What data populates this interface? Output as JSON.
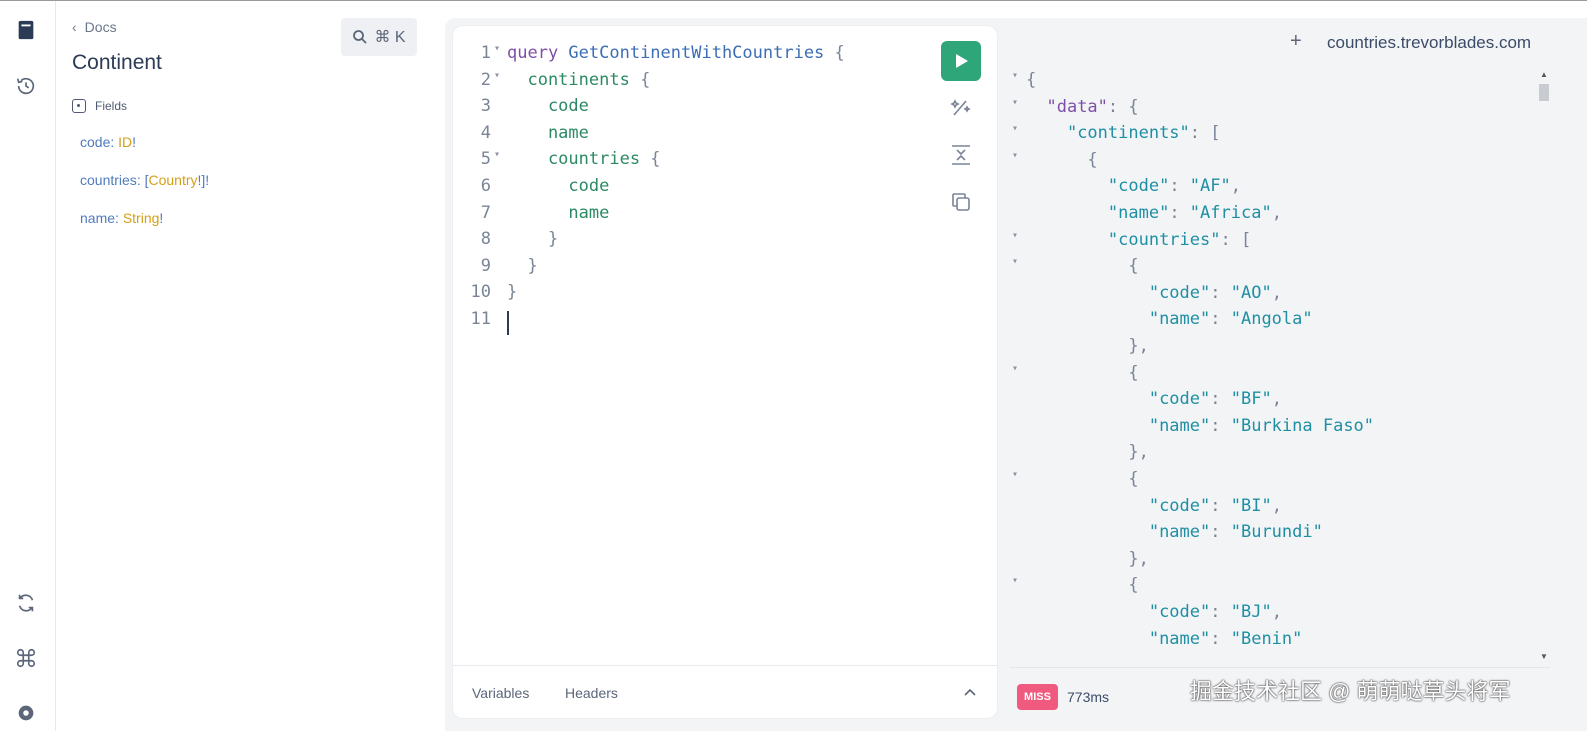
{
  "sidebar": {
    "icons": [
      "docs-book-icon",
      "history-icon",
      "refetch-schema-icon",
      "command-icon",
      "settings-gear-icon"
    ]
  },
  "docs": {
    "back_label": "Docs",
    "title": "Continent",
    "search_shortcut": "⌘ K",
    "fields_heading": "Fields",
    "fields": [
      {
        "name": "code",
        "sep": ": ",
        "pre": "",
        "type": "ID",
        "post": "!"
      },
      {
        "name": "countries",
        "sep": ": ",
        "pre": "[",
        "type": "Country",
        "post": "!]!"
      },
      {
        "name": "name",
        "sep": ": ",
        "pre": "",
        "type": "String",
        "post": "!"
      }
    ]
  },
  "editor": {
    "lines": [
      {
        "n": "1",
        "fold": true,
        "parts": [
          [
            "kw",
            "query "
          ],
          [
            "fn",
            "GetContinentWithCountries"
          ],
          [
            "pn",
            " {"
          ]
        ]
      },
      {
        "n": "2",
        "fold": true,
        "parts": [
          [
            "fld",
            "  continents"
          ],
          [
            "pn",
            " {"
          ]
        ]
      },
      {
        "n": "3",
        "fold": false,
        "parts": [
          [
            "fld",
            "    code"
          ]
        ]
      },
      {
        "n": "4",
        "fold": false,
        "parts": [
          [
            "fld",
            "    name"
          ]
        ]
      },
      {
        "n": "5",
        "fold": true,
        "parts": [
          [
            "fld",
            "    countries"
          ],
          [
            "pn",
            " {"
          ]
        ]
      },
      {
        "n": "6",
        "fold": false,
        "parts": [
          [
            "fld",
            "      code"
          ]
        ]
      },
      {
        "n": "7",
        "fold": false,
        "parts": [
          [
            "fld",
            "      name"
          ]
        ]
      },
      {
        "n": "8",
        "fold": false,
        "parts": [
          [
            "pn",
            "    }"
          ]
        ]
      },
      {
        "n": "9",
        "fold": false,
        "parts": [
          [
            "pn",
            "  }"
          ]
        ]
      },
      {
        "n": "10",
        "fold": false,
        "parts": [
          [
            "pn",
            "}"
          ]
        ]
      },
      {
        "n": "11",
        "fold": false,
        "parts": []
      }
    ],
    "tabs": {
      "variables": "Variables",
      "headers": "Headers"
    }
  },
  "results": {
    "add_tab": "+",
    "host": "countries.trevorblades.com",
    "lines": [
      {
        "fold": true,
        "parts": [
          [
            "rp",
            "{"
          ]
        ]
      },
      {
        "fold": true,
        "parts": [
          [
            "rp",
            "  "
          ],
          [
            "dkey",
            "\"data\""
          ],
          [
            "rp",
            ": {"
          ]
        ]
      },
      {
        "fold": true,
        "parts": [
          [
            "rp",
            "    "
          ],
          [
            "key",
            "\"continents\""
          ],
          [
            "rp",
            ": ["
          ]
        ]
      },
      {
        "fold": true,
        "parts": [
          [
            "rp",
            "      {"
          ]
        ]
      },
      {
        "fold": false,
        "parts": [
          [
            "rp",
            "        "
          ],
          [
            "key",
            "\"code\""
          ],
          [
            "rp",
            ": "
          ],
          [
            "str",
            "\"AF\""
          ],
          [
            "rp",
            ","
          ]
        ]
      },
      {
        "fold": false,
        "parts": [
          [
            "rp",
            "        "
          ],
          [
            "key",
            "\"name\""
          ],
          [
            "rp",
            ": "
          ],
          [
            "str",
            "\"Africa\""
          ],
          [
            "rp",
            ","
          ]
        ]
      },
      {
        "fold": true,
        "parts": [
          [
            "rp",
            "        "
          ],
          [
            "key",
            "\"countries\""
          ],
          [
            "rp",
            ": ["
          ]
        ]
      },
      {
        "fold": true,
        "parts": [
          [
            "rp",
            "          {"
          ]
        ]
      },
      {
        "fold": false,
        "parts": [
          [
            "rp",
            "            "
          ],
          [
            "key",
            "\"code\""
          ],
          [
            "rp",
            ": "
          ],
          [
            "str",
            "\"AO\""
          ],
          [
            "rp",
            ","
          ]
        ]
      },
      {
        "fold": false,
        "parts": [
          [
            "rp",
            "            "
          ],
          [
            "key",
            "\"name\""
          ],
          [
            "rp",
            ": "
          ],
          [
            "str",
            "\"Angola\""
          ]
        ]
      },
      {
        "fold": false,
        "parts": [
          [
            "rp",
            "          },"
          ]
        ]
      },
      {
        "fold": true,
        "parts": [
          [
            "rp",
            "          {"
          ]
        ]
      },
      {
        "fold": false,
        "parts": [
          [
            "rp",
            "            "
          ],
          [
            "key",
            "\"code\""
          ],
          [
            "rp",
            ": "
          ],
          [
            "str",
            "\"BF\""
          ],
          [
            "rp",
            ","
          ]
        ]
      },
      {
        "fold": false,
        "parts": [
          [
            "rp",
            "            "
          ],
          [
            "key",
            "\"name\""
          ],
          [
            "rp",
            ": "
          ],
          [
            "str",
            "\"Burkina Faso\""
          ]
        ]
      },
      {
        "fold": false,
        "parts": [
          [
            "rp",
            "          },"
          ]
        ]
      },
      {
        "fold": true,
        "parts": [
          [
            "rp",
            "          {"
          ]
        ]
      },
      {
        "fold": false,
        "parts": [
          [
            "rp",
            "            "
          ],
          [
            "key",
            "\"code\""
          ],
          [
            "rp",
            ": "
          ],
          [
            "str",
            "\"BI\""
          ],
          [
            "rp",
            ","
          ]
        ]
      },
      {
        "fold": false,
        "parts": [
          [
            "rp",
            "            "
          ],
          [
            "key",
            "\"name\""
          ],
          [
            "rp",
            ": "
          ],
          [
            "str",
            "\"Burundi\""
          ]
        ]
      },
      {
        "fold": false,
        "parts": [
          [
            "rp",
            "          },"
          ]
        ]
      },
      {
        "fold": true,
        "parts": [
          [
            "rp",
            "          {"
          ]
        ]
      },
      {
        "fold": false,
        "parts": [
          [
            "rp",
            "            "
          ],
          [
            "key",
            "\"code\""
          ],
          [
            "rp",
            ": "
          ],
          [
            "str",
            "\"BJ\""
          ],
          [
            "rp",
            ","
          ]
        ]
      },
      {
        "fold": false,
        "parts": [
          [
            "rp",
            "            "
          ],
          [
            "key",
            "\"name\""
          ],
          [
            "rp",
            ": "
          ],
          [
            "str",
            "\"Benin\""
          ]
        ]
      }
    ],
    "cache_status": "MISS",
    "timing": "773ms"
  },
  "watermark": "掘金技术社区 @ 萌萌哒草头将军",
  "colors": {
    "accent_run": "#2fa57a",
    "miss_badge": "#f05a7e",
    "keyword": "#7e4fa8",
    "field": "#2b8a63",
    "json_key": "#1f8fa4"
  }
}
